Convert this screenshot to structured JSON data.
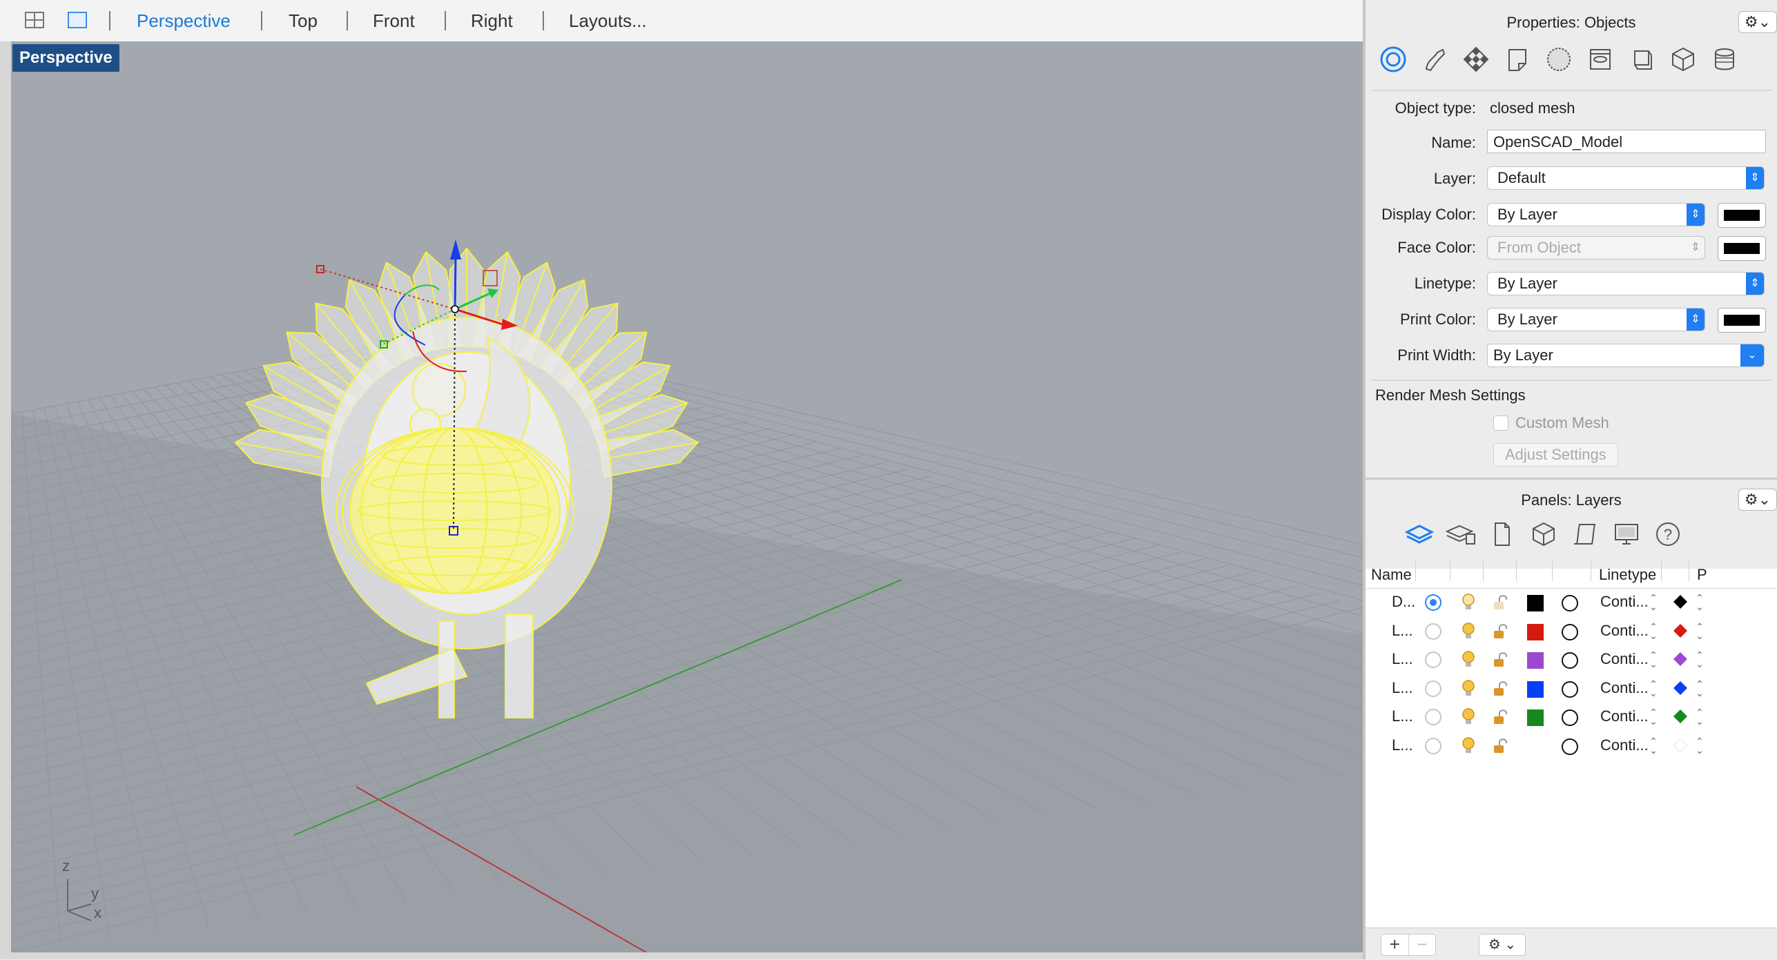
{
  "toolbar": {
    "tabs": [
      "Perspective",
      "Top",
      "Front",
      "Right",
      "Layouts..."
    ],
    "active_tab": "Perspective"
  },
  "viewport": {
    "label": "Perspective",
    "axes": {
      "z": "z",
      "y": "y",
      "x": "x"
    },
    "model_color": "#f4f04a",
    "grid_color": "#8a9098",
    "background": "#a3a8ae"
  },
  "properties": {
    "title": "Properties: Objects",
    "gear": "⚙︎⌄",
    "icons": [
      "object-icon",
      "curve-icon",
      "material-icon",
      "decal-icon",
      "texture-icon",
      "mapping-icon",
      "shadow-icon",
      "block-icon",
      "layer-stack-icon"
    ],
    "object_type_label": "Object type:",
    "object_type_value": "closed mesh",
    "name_label": "Name:",
    "name_value": "OpenSCAD_Model",
    "layer_label": "Layer:",
    "layer_value": "Default",
    "display_color_label": "Display Color:",
    "display_color_value": "By Layer",
    "face_color_label": "Face Color:",
    "face_color_value": "From Object",
    "linetype_label": "Linetype:",
    "linetype_value": "By Layer",
    "print_color_label": "Print Color:",
    "print_color_value": "By Layer",
    "print_width_label": "Print Width:",
    "print_width_value": "By Layer",
    "render_mesh_heading": "Render Mesh Settings",
    "custom_mesh_label": "Custom Mesh",
    "adjust_settings_label": "Adjust Settings"
  },
  "layers_panel": {
    "title": "Panels: Layers",
    "gear": "⚙︎⌄",
    "columns": {
      "name": "Name",
      "linetype": "Linetype",
      "print": "P"
    },
    "rows": [
      {
        "name": "D...",
        "current": true,
        "color": "#000000",
        "linetype": "Conti...",
        "print_color": "#000000"
      },
      {
        "name": "L...",
        "current": false,
        "color": "#d41b0e",
        "linetype": "Conti...",
        "print_color": "#d41b0e"
      },
      {
        "name": "L...",
        "current": false,
        "color": "#9b49d3",
        "linetype": "Conti...",
        "print_color": "#9b49d3"
      },
      {
        "name": "L...",
        "current": false,
        "color": "#0b3df5",
        "linetype": "Conti...",
        "print_color": "#0b3df5"
      },
      {
        "name": "L...",
        "current": false,
        "color": "#138a1b",
        "linetype": "Conti...",
        "print_color": "#138a1b"
      },
      {
        "name": "L...",
        "current": false,
        "color": "#ffffff",
        "linetype": "Conti...",
        "print_color": "#ffffff"
      }
    ],
    "add_label": "+",
    "remove_label": "−",
    "options_label": "⚙︎ ⌄"
  }
}
